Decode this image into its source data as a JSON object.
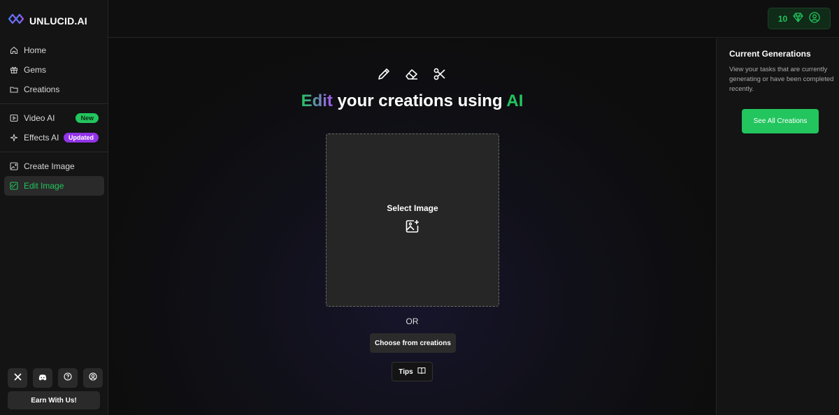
{
  "brand": {
    "name": "UNLUCID.AI"
  },
  "nav": {
    "group1": [
      {
        "label": "Home",
        "icon": "home-icon"
      },
      {
        "label": "Gems",
        "icon": "gift-icon"
      },
      {
        "label": "Creations",
        "icon": "folder-icon"
      }
    ],
    "group2": [
      {
        "label": "Video AI",
        "icon": "video-icon",
        "badge": "New"
      },
      {
        "label": "Effects AI",
        "icon": "sparkles-icon",
        "badge": "Updated"
      }
    ],
    "group3": [
      {
        "label": "Create Image",
        "icon": "image-plus-icon"
      },
      {
        "label": "Edit Image",
        "icon": "image-edit-icon",
        "active": true
      }
    ]
  },
  "footer": {
    "social": [
      "x-icon",
      "discord-icon",
      "help-icon",
      "user-icon"
    ],
    "earn_label": "Earn With Us!"
  },
  "topbar": {
    "gem_count": "10"
  },
  "main": {
    "headline": {
      "part1": "Edit",
      "part2": " your creations using ",
      "part3": "AI"
    },
    "tools": [
      "pencil-icon",
      "eraser-icon",
      "scissors-icon"
    ],
    "dropzone_label": "Select Image",
    "or_text": "OR",
    "choose_label": "Choose from creations",
    "tips_label": "Tips"
  },
  "right_panel": {
    "title": "Current Generations",
    "description": "View your tasks that are currently generating or have been completed recently.",
    "button_label": "See All Creations"
  },
  "colors": {
    "accent": "#22c55e",
    "purple": "#9333ea",
    "bg": "#0e0e0e"
  }
}
